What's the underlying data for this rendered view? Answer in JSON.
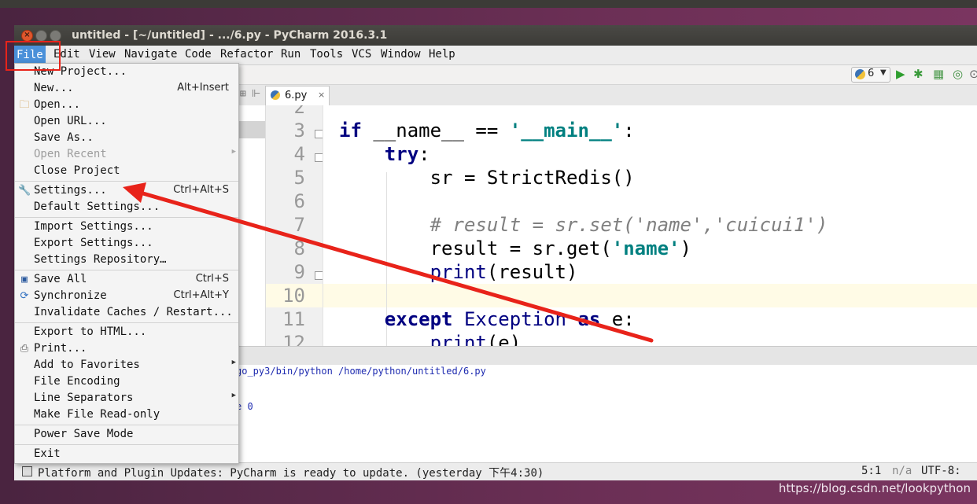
{
  "window": {
    "title": "untitled - [~/untitled] - .../6.py - PyCharm 2016.3.1",
    "close_glyph": "×"
  },
  "menubar": {
    "items": [
      "File",
      "Edit",
      "View",
      "Navigate",
      "Code",
      "Refactor",
      "Run",
      "Tools",
      "VCS",
      "Window",
      "Help"
    ],
    "active": "File"
  },
  "toolbar": {
    "run_config": "6",
    "run_config_icon": "python-file-icon"
  },
  "tabs": [
    {
      "label": "6.py",
      "icon": "python-file-icon",
      "close": "×"
    }
  ],
  "editor": {
    "line_numbers": [
      "2",
      "3",
      "4",
      "5",
      "6",
      "7",
      "8",
      "9",
      "10",
      "11",
      "12"
    ],
    "current_line": "10"
  },
  "console": {
    "command_fragment": "go_py3/bin/python /home/python/untitled/6.py",
    "exit_fragment": "e 0"
  },
  "statusbar": {
    "message": "Platform and Plugin Updates: PyCharm is ready to update. (yesterday 下午4:30)",
    "position": "5:1",
    "na": "n/a",
    "encoding": "UTF-8:"
  },
  "file_menu": {
    "items": [
      {
        "label": "New Project...",
        "shortcut": ""
      },
      {
        "label": "New...",
        "shortcut": "Alt+Insert"
      },
      {
        "label": "Open...",
        "shortcut": "",
        "icon": "folder-icon"
      },
      {
        "label": "Open URL...",
        "shortcut": ""
      },
      {
        "label": "Save As..",
        "shortcut": ""
      },
      {
        "label": "Open Recent",
        "shortcut": "",
        "disabled": true,
        "submenu": true
      },
      {
        "label": "Close Project",
        "shortcut": ""
      },
      {
        "label": "Settings...",
        "shortcut": "Ctrl+Alt+S",
        "icon": "wrench-icon"
      },
      {
        "label": "Default Settings...",
        "shortcut": ""
      },
      {
        "label": "Import Settings...",
        "shortcut": ""
      },
      {
        "label": "Export Settings...",
        "shortcut": ""
      },
      {
        "label": "Settings Repository…",
        "shortcut": ""
      },
      {
        "label": "Save All",
        "shortcut": "Ctrl+S",
        "icon": "save-icon"
      },
      {
        "label": "Synchronize",
        "shortcut": "Ctrl+Alt+Y",
        "icon": "sync-icon"
      },
      {
        "label": "Invalidate Caches / Restart...",
        "shortcut": ""
      },
      {
        "label": "Export to HTML...",
        "shortcut": ""
      },
      {
        "label": "Print...",
        "shortcut": "",
        "icon": "print-icon"
      },
      {
        "label": "Add to Favorites",
        "shortcut": "",
        "submenu": true
      },
      {
        "label": "File Encoding",
        "shortcut": ""
      },
      {
        "label": "Line Separators",
        "shortcut": "",
        "submenu": true
      },
      {
        "label": "Make File Read-only",
        "shortcut": ""
      },
      {
        "label": "Power Save Mode",
        "shortcut": ""
      },
      {
        "label": "Exit",
        "shortcut": ""
      }
    ],
    "submenu_glyph": "▶"
  },
  "watermark": "https://blog.csdn.net/lookpython"
}
